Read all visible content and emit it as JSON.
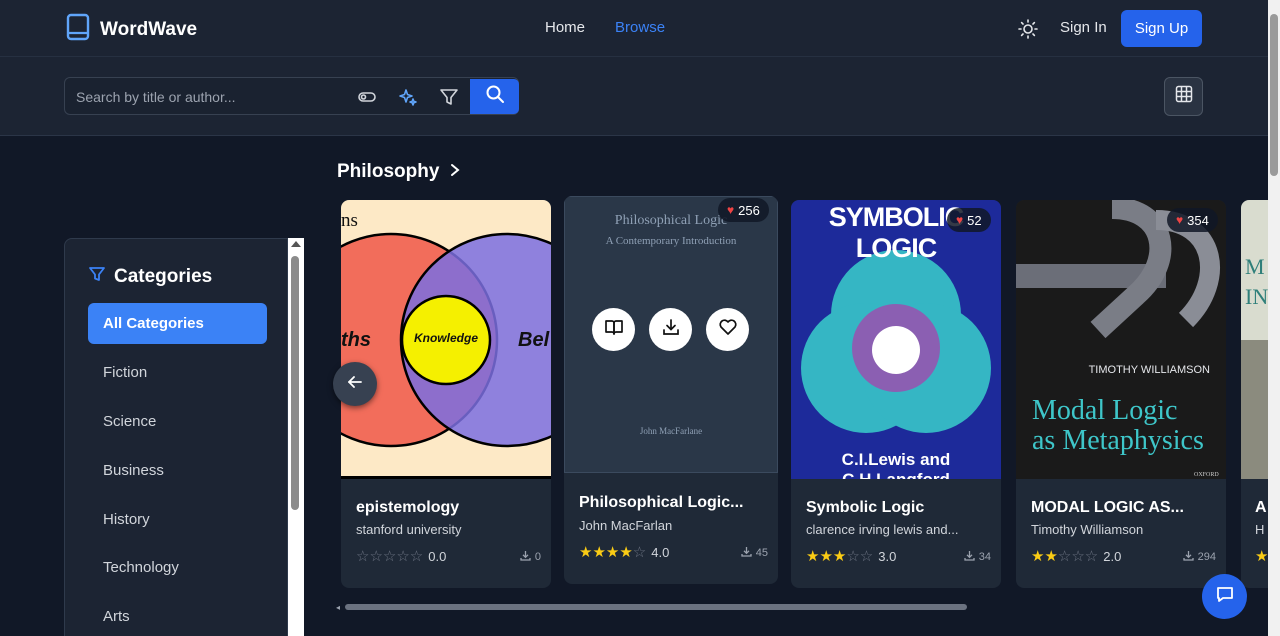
{
  "header": {
    "brand": "WordWave",
    "nav": {
      "home": "Home",
      "browse": "Browse"
    },
    "sign_in": "Sign In",
    "sign_up": "Sign Up"
  },
  "search": {
    "placeholder": "Search by title or author..."
  },
  "section": {
    "title": "Philosophy"
  },
  "sidebar": {
    "title": "Categories",
    "items": [
      {
        "label": "All Categories"
      },
      {
        "label": "Fiction"
      },
      {
        "label": "Science"
      },
      {
        "label": "Business"
      },
      {
        "label": "History"
      },
      {
        "label": "Technology"
      },
      {
        "label": "Arts"
      }
    ]
  },
  "books": [
    {
      "title": "epistemology",
      "author": "stanford university",
      "rating": 0,
      "rating_text": "0.0",
      "downloads": "0",
      "cover": {
        "left_word": "ths",
        "right_word": "Bel",
        "center": "Knowledge",
        "top_fragment": "ns"
      }
    },
    {
      "title": "Philosophical Logic...",
      "author": "John MacFarlan",
      "rating": 4,
      "rating_text": "4.0",
      "downloads": "45",
      "likes": "256",
      "cover": {
        "title": "Philosophical Logic",
        "subtitle": "A Contemporary Introduction",
        "author": "John MacFarlane"
      }
    },
    {
      "title": "Symbolic Logic",
      "author": "clarence irving lewis and...",
      "rating": 3,
      "rating_text": "3.0",
      "downloads": "34",
      "likes": "52",
      "cover": {
        "title": "SYMBOLIC LOGIC",
        "authors": "C.I.Lewis and C.H.Langford"
      }
    },
    {
      "title": "MODAL LOGIC AS...",
      "author": "Timothy Williamson",
      "rating": 2,
      "rating_text": "2.0",
      "downloads": "294",
      "likes": "354",
      "cover": {
        "author": "TIMOTHY WILLIAMSON",
        "title_line1": "Modal Logic",
        "title_line2": "as Metaphysics",
        "publisher": "OXFORD"
      }
    },
    {
      "title": "A",
      "author": "H",
      "cover": {
        "fragment": "M\nIN"
      }
    }
  ]
}
